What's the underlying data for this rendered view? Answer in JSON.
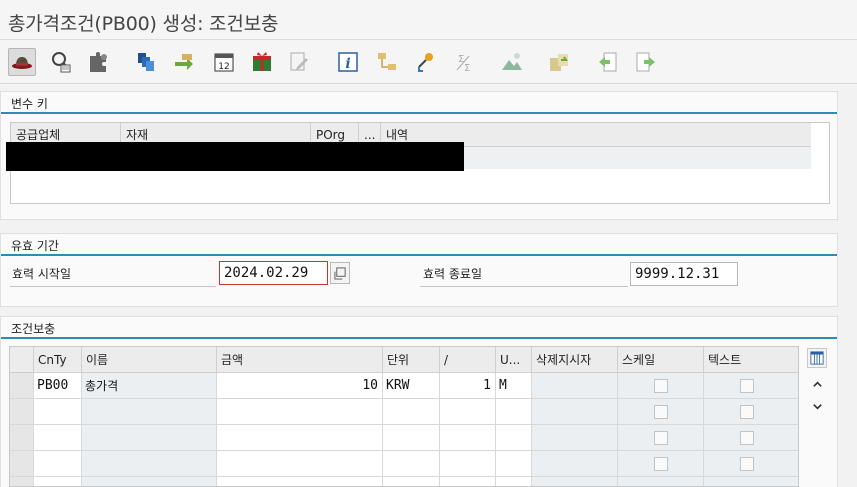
{
  "window": {
    "title": "총가격조건(PB00) 생성: 조건보충"
  },
  "toolbar": {
    "icons": [
      "hat-icon",
      "search-list-icon",
      "puzzle-icon",
      "stack-icon",
      "forward-arrow-icon",
      "calendar-icon",
      "gift-icon",
      "edit-icon",
      "info-icon",
      "structure-icon",
      "key-icon",
      "sum-icon",
      "image-icon",
      "import-icon",
      "back-page-icon",
      "next-page-icon"
    ],
    "calendar_day": "12"
  },
  "variable_key": {
    "title": "변수 키",
    "columns": [
      "공급업체",
      "자재",
      "POrg",
      "...",
      "내역"
    ],
    "rows": [
      [
        "",
        "",
        "",
        "",
        ""
      ]
    ]
  },
  "validity": {
    "title": "유효 기간",
    "start_label": "효력 시작일",
    "start_value": "2024.02.29",
    "end_label": "효력 종료일",
    "end_value": "9999.12.31"
  },
  "conditions": {
    "title": "조건보충",
    "columns": [
      "CnTy",
      "이름",
      "금액",
      "단위",
      "/",
      "U...",
      "삭제지시자",
      "스케일",
      "텍스트"
    ],
    "rows": [
      {
        "cnty": "PB00",
        "name": "총가격",
        "amount": "10",
        "unit": "KRW",
        "per": "1",
        "uom": "M"
      },
      {
        "cnty": "",
        "name": "",
        "amount": "",
        "unit": "",
        "per": "",
        "uom": ""
      },
      {
        "cnty": "",
        "name": "",
        "amount": "",
        "unit": "",
        "per": "",
        "uom": ""
      },
      {
        "cnty": "",
        "name": "",
        "amount": "",
        "unit": "",
        "per": "",
        "uom": ""
      },
      {
        "cnty": "",
        "name": "",
        "amount": "",
        "unit": "",
        "per": "",
        "uom": ""
      }
    ]
  },
  "colors": {
    "accent_line": "#2b8cb6",
    "focus_border": "#c0392b"
  }
}
